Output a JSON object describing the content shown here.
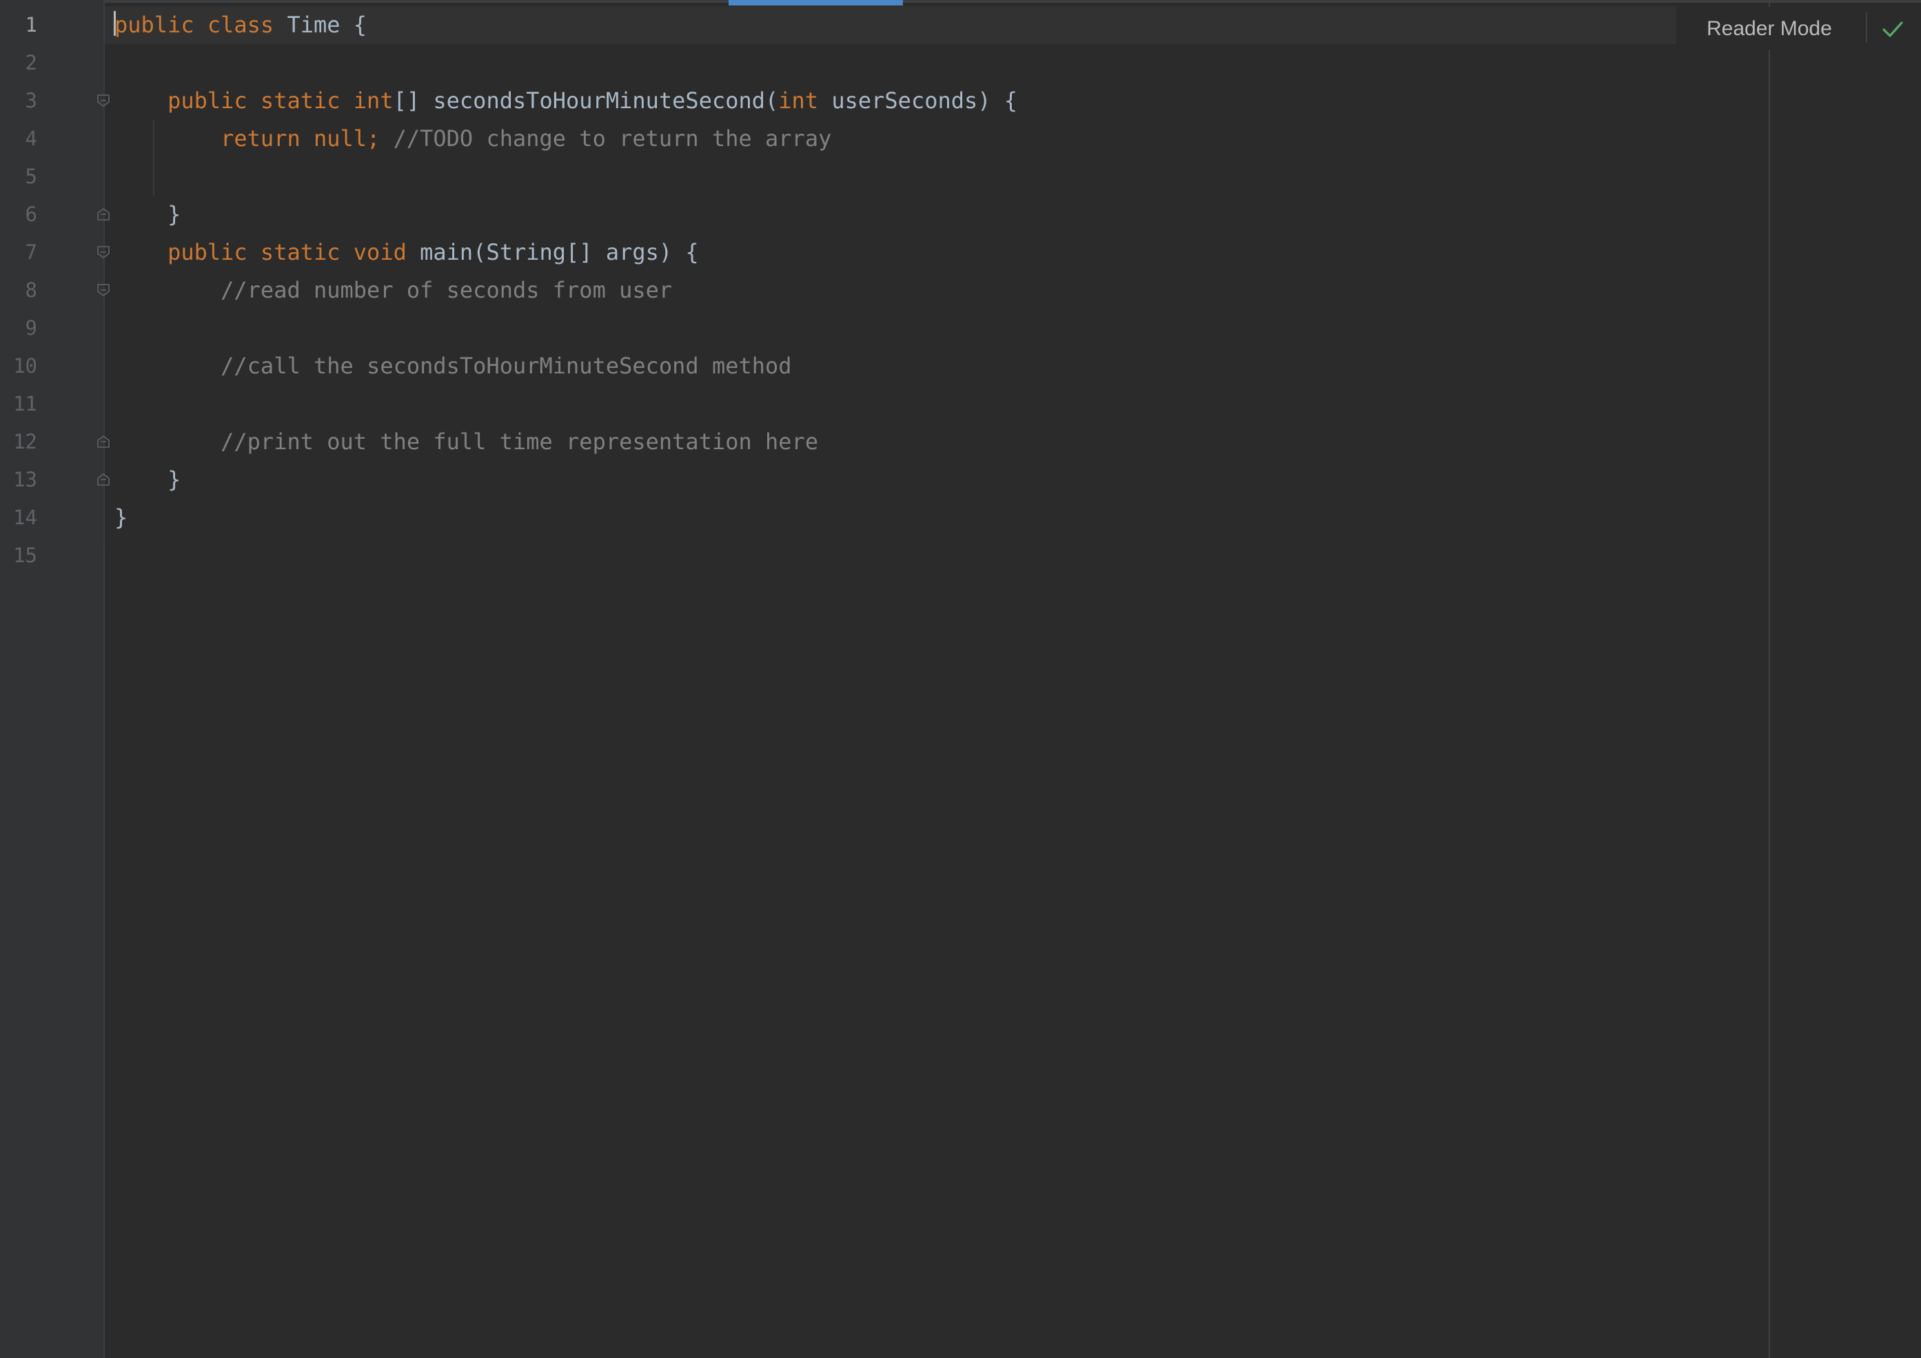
{
  "editor": {
    "reader_mode_label": "Reader Mode",
    "status_icon": "check-icon",
    "active_line": 1,
    "lines": [
      {
        "number": "1",
        "code": [
          {
            "t": "public class ",
            "c": "kw"
          },
          {
            "t": "Time {",
            "c": "id"
          }
        ]
      },
      {
        "number": "2",
        "code": []
      },
      {
        "number": "3",
        "code": [
          {
            "t": "    ",
            "c": "id"
          },
          {
            "t": "public static int",
            "c": "kw"
          },
          {
            "t": "[] secondsToHourMinuteSecond(",
            "c": "id"
          },
          {
            "t": "int ",
            "c": "kw"
          },
          {
            "t": "userSeconds) {",
            "c": "id"
          }
        ]
      },
      {
        "number": "4",
        "code": [
          {
            "t": "        ",
            "c": "id"
          },
          {
            "t": "return null; ",
            "c": "kw"
          },
          {
            "t": "//TODO change to return the array",
            "c": "cm"
          }
        ]
      },
      {
        "number": "5",
        "code": []
      },
      {
        "number": "6",
        "code": [
          {
            "t": "    }",
            "c": "id"
          }
        ]
      },
      {
        "number": "7",
        "code": [
          {
            "t": "    ",
            "c": "id"
          },
          {
            "t": "public static void ",
            "c": "kw"
          },
          {
            "t": "main(String[] args) {",
            "c": "id"
          }
        ]
      },
      {
        "number": "8",
        "code": [
          {
            "t": "        ",
            "c": "id"
          },
          {
            "t": "//read number of seconds from user",
            "c": "cm"
          }
        ]
      },
      {
        "number": "9",
        "code": []
      },
      {
        "number": "10",
        "code": [
          {
            "t": "        ",
            "c": "id"
          },
          {
            "t": "//call the secondsToHourMinuteSecond method",
            "c": "cm"
          }
        ]
      },
      {
        "number": "11",
        "code": []
      },
      {
        "number": "12",
        "code": [
          {
            "t": "        ",
            "c": "id"
          },
          {
            "t": "//print out the full time representation here",
            "c": "cm"
          }
        ]
      },
      {
        "number": "13",
        "code": [
          {
            "t": "    }",
            "c": "id"
          }
        ]
      },
      {
        "number": "14",
        "code": [
          {
            "t": "}",
            "c": "id"
          }
        ]
      },
      {
        "number": "15",
        "code": []
      }
    ],
    "fold_markers": [
      {
        "line": 3,
        "kind": "fold-open-icon"
      },
      {
        "line": 6,
        "kind": "fold-close-icon"
      },
      {
        "line": 7,
        "kind": "fold-open-icon"
      },
      {
        "line": 8,
        "kind": "fold-open-icon"
      },
      {
        "line": 12,
        "kind": "fold-close-icon"
      },
      {
        "line": 13,
        "kind": "fold-close-icon"
      }
    ],
    "colors": {
      "background": "#2b2b2b",
      "keyword": "#cc7832",
      "identifier": "#a9b7c6",
      "comment": "#808080",
      "line_number": "#606366",
      "accent": "#4a88c7",
      "check": "#59a869"
    }
  }
}
